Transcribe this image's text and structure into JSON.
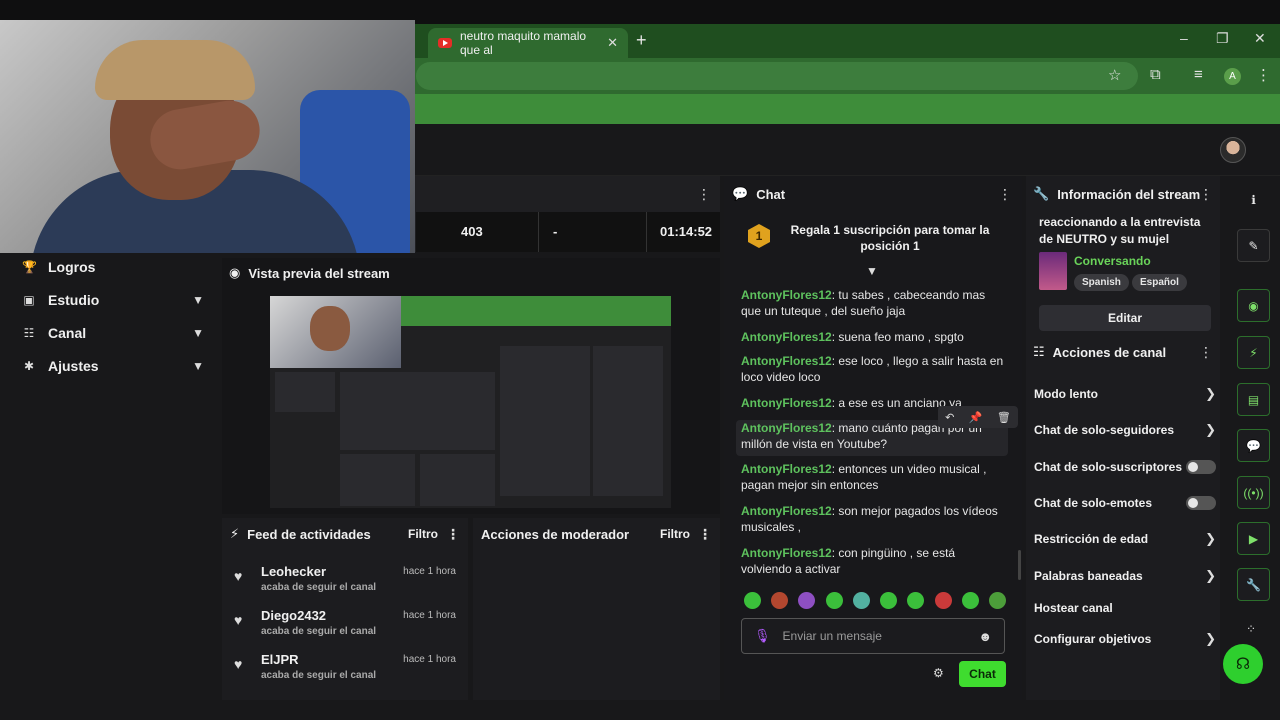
{
  "browser": {
    "tab_title": "neutro maquito mamalo que al",
    "new_tab": "+",
    "minimize": "–",
    "maximize": "❐",
    "close": "✕",
    "profile_letter": "A"
  },
  "sidebar": {
    "items": [
      {
        "label": "Logros",
        "icon": "trophy-icon"
      },
      {
        "label": "Estudio",
        "icon": "studio-icon"
      },
      {
        "label": "Canal",
        "icon": "channel-icon"
      },
      {
        "label": "Ajustes",
        "icon": "settings-icon"
      }
    ]
  },
  "stats": {
    "values": [
      "403",
      "-",
      "01:14:52"
    ]
  },
  "preview": {
    "title": "Vista previa del stream"
  },
  "feed": {
    "title": "Feed de actividades",
    "filter": "Filtro",
    "items": [
      {
        "name": "Leohecker",
        "sub": "acaba de seguir el canal",
        "time": "hace 1 hora"
      },
      {
        "name": "Diego2432",
        "sub": "acaba de seguir el canal",
        "time": "hace 1 hora"
      },
      {
        "name": "ElJPR",
        "sub": "acaba de seguir el canal",
        "time": "hace 1 hora"
      }
    ]
  },
  "mod": {
    "title": "Acciones de moderador",
    "filter": "Filtro"
  },
  "chat": {
    "title": "Chat",
    "sub_badge": "1",
    "sub_text": "Regala 1 suscripción para tomar la posición 1",
    "messages": [
      {
        "user": "AntonyFlores12",
        "text": ": tu sabes , cabeceando mas que un tuteque , del sueño jaja"
      },
      {
        "user": "AntonyFlores12",
        "text": ": suena feo mano , spgto"
      },
      {
        "user": "AntonyFlores12",
        "text": ": ese loco , llego a salir hasta en loco video loco"
      },
      {
        "user": "AntonyFlores12",
        "text": ": a ese es un anciano ya"
      },
      {
        "user": "AntonyFlores12",
        "text": ": mano cuánto pagan por un millón de vista en Youtube?"
      },
      {
        "user": "AntonyFlores12",
        "text": ": entonces un video musical , pagan mejor sin entonces"
      },
      {
        "user": "AntonyFlores12",
        "text": ": son mejor pagados los vídeos musicales ,"
      },
      {
        "user": "AntonyFlores12",
        "text": ": con pingüino , se está volviendo a activar"
      }
    ],
    "input_placeholder": "Enviar un mensaje",
    "send_label": "Chat"
  },
  "info": {
    "title": "Información del stream",
    "stream_title": "reaccionando a la entrevista de NEUTRO y su mujel",
    "category": "Conversando",
    "tags": [
      "Spanish",
      "Español"
    ],
    "edit_label": "Editar"
  },
  "actions": {
    "title": "Acciones de canal",
    "items": [
      {
        "label": "Modo lento",
        "control": "chevron"
      },
      {
        "label": "Chat de solo-seguidores",
        "control": "chevron"
      },
      {
        "label": "Chat de solo-suscriptores",
        "control": "toggle"
      },
      {
        "label": "Chat de solo-emotes",
        "control": "toggle"
      },
      {
        "label": "Restricción de edad",
        "control": "chevron"
      },
      {
        "label": "Palabras baneadas",
        "control": "chevron"
      },
      {
        "label": "Hostear canal",
        "control": "none"
      },
      {
        "label": "Configurar objetivos",
        "control": "chevron"
      }
    ]
  },
  "colors": {
    "accent_green": "#3fdc2f",
    "username_green": "#5ec25e",
    "browser_green": "#2f6a2f"
  }
}
